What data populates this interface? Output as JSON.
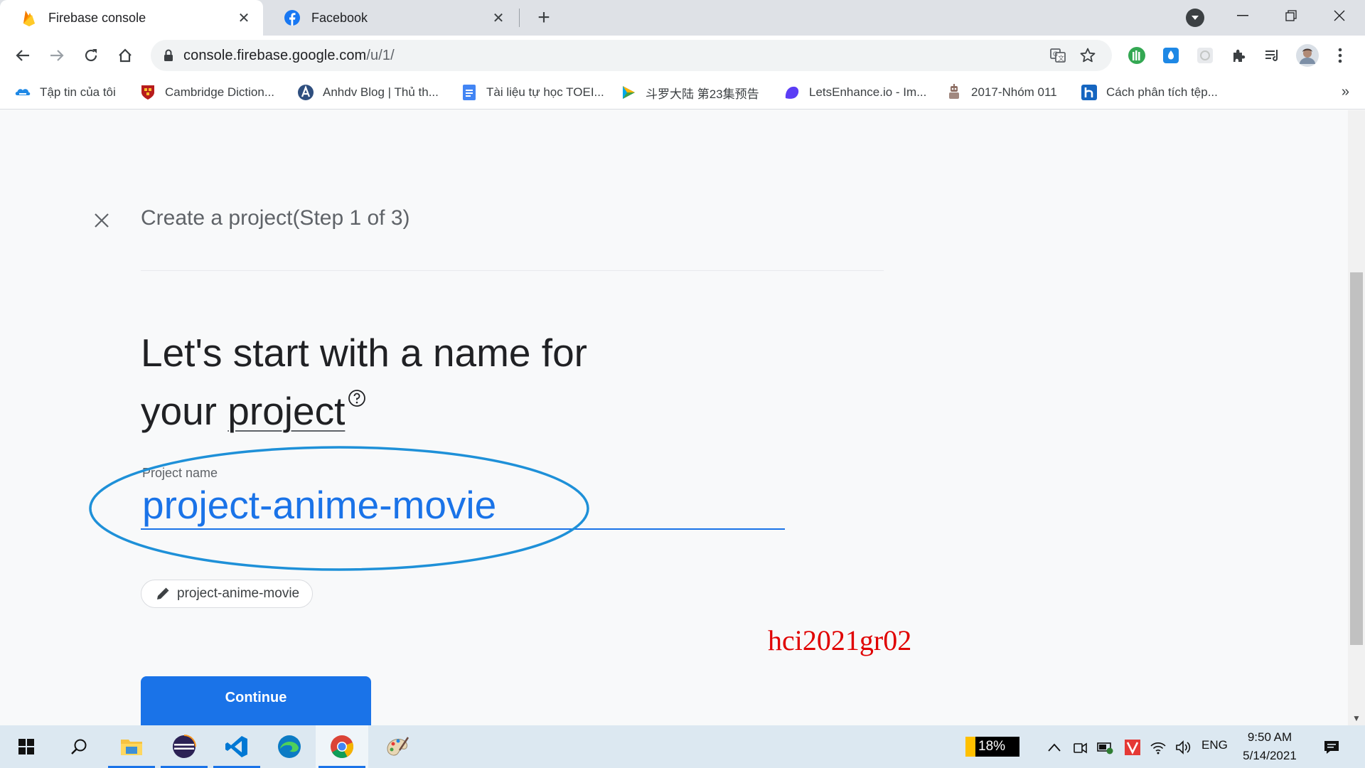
{
  "browser": {
    "tabs": [
      {
        "title": "Firebase console",
        "icon": "firebase-icon",
        "active": true
      },
      {
        "title": "Facebook",
        "icon": "facebook-icon",
        "active": false
      }
    ],
    "url_host": "console.firebase.google.com",
    "url_path": "/u/1/",
    "bookmarks": [
      {
        "label": "Tập tin của tôi",
        "icon": "cloud-folder-icon"
      },
      {
        "label": "Cambridge Diction...",
        "icon": "cambridge-shield-icon"
      },
      {
        "label": "Anhdv Blog | Thủ th...",
        "icon": "a-logo-icon"
      },
      {
        "label": "Tài liệu tự học TOEI...",
        "icon": "google-docs-icon"
      },
      {
        "label": "斗罗大陆 第23集预告",
        "icon": "play-video-icon"
      },
      {
        "label": "LetsEnhance.io - Im...",
        "icon": "letsenhance-icon"
      },
      {
        "label": "2017-Nhóm 011",
        "icon": "robot-icon"
      },
      {
        "label": "Cách phân tích tệp...",
        "icon": "h-logo-icon"
      }
    ],
    "bookmarks_more": "»"
  },
  "page": {
    "step_title": "Create a project(Step 1 of 3)",
    "headline_part1": "Let's start with a name for",
    "headline_part2": "your",
    "headline_link": "project",
    "field_label": "Project name",
    "field_value": "project-anime-movie",
    "project_id": "project-anime-movie",
    "watermark": "hci2021gr02",
    "continue_label": "Continue"
  },
  "taskbar": {
    "battery_percent": "18%",
    "language": "ENG",
    "time": "9:50 AM",
    "date": "5/14/2021"
  },
  "colors": {
    "accent": "#1a73e8",
    "annotation_ellipse": "#1e90d8",
    "watermark": "#e00000"
  }
}
